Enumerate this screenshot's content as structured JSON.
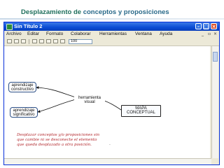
{
  "slide": {
    "title_part1": "Desplazamiento de ",
    "title_part2": "conceptos y proposiciones"
  },
  "window": {
    "title": "Sin Título 2",
    "menu": [
      "Archivo",
      "Editar",
      "Formato",
      "Colaborar",
      "Herramientas",
      "Ventana",
      "Ayuda"
    ],
    "zoom": "100"
  },
  "map": {
    "concepts": {
      "aprendizaje_constructivo": "aprendizaje\nconstructivo",
      "aprendizaje_significativo": "aprendizaje\nsignificativo",
      "mapa_conceptual": "MAPA\nCONCEPTUAL"
    },
    "linking_phrase": "herramienta\nvisual",
    "note": "Desplazar conceptos y/o proposiciones sin\nque cambie ni se desconecte el elemento\nque queda desplazado a otra posición."
  },
  "colors": {
    "title_green": "#1f6f5c",
    "title_blue": "#2a6a8a",
    "window_blue": "#0a4bd4",
    "note_red": "#b3282d"
  }
}
